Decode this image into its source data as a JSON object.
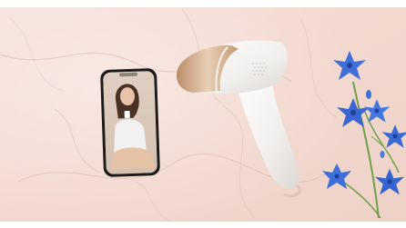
{
  "image": {
    "subject": "ipl-device-product-photo",
    "background": "pink-marble",
    "objects": [
      "smartphone",
      "ipl-hair-removal-device",
      "blue-flowers"
    ],
    "colors": {
      "marble_base": "#f2d9d2",
      "marble_vein": "#d9b8ae",
      "device_body": "#f5f3f1",
      "device_accent": "#c9a27c",
      "phone_frame": "#1a1a1a",
      "flower_blue": "#3f6fd8",
      "stem_green": "#6fa04a"
    }
  }
}
